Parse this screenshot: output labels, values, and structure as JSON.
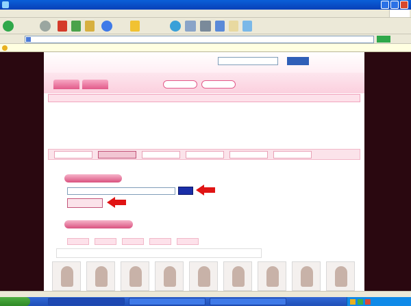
{
  "window": {
    "title": ""
  },
  "menu": {
    "items": [
      "",
      "",
      "",
      "",
      "",
      ""
    ]
  },
  "toolbar": {
    "back_label": "",
    "search_label": "",
    "favorites_label": ""
  },
  "address": {
    "label": "",
    "url": "",
    "go_label": "",
    "links_label": ""
  },
  "infobar": {
    "message": ""
  },
  "site": {
    "logo_primary": "",
    "logo_secondary": "",
    "tagline": "",
    "search_value": "",
    "search_button": "",
    "search_link": "",
    "main_tabs": [
      "",
      ""
    ],
    "sub_buttons": [
      "",
      ""
    ],
    "categories": [
      "",
      "",
      "",
      "",
      "",
      "",
      "",
      "",
      "",
      "",
      "",
      "",
      "",
      ""
    ],
    "ads": [
      {
        "title": "",
        "body": "",
        "url": ""
      },
      {
        "title": "",
        "body": "",
        "url": ""
      },
      {
        "title": "",
        "body": "",
        "url": ""
      },
      {
        "title": "",
        "body": "",
        "url": ""
      }
    ],
    "ads_by": "",
    "steps": [
      "",
      "",
      "",
      "",
      "",
      ""
    ],
    "upload_section_label": "",
    "browse_button": "",
    "upload_button": "",
    "gallery_section_label": "",
    "thumb_tabs": [
      "",
      "",
      "",
      "",
      ""
    ],
    "gallery_filter": ""
  },
  "annotations": {
    "step3": "",
    "step4": "",
    "arrow3_number": "",
    "arrow4_number": "",
    "overlay": ""
  },
  "statusbar": {
    "text": ""
  },
  "taskbar": {
    "start_label": "",
    "tasks": [
      "",
      "",
      ""
    ],
    "clock": ""
  },
  "colors": {
    "ie_blue": "#0840b8",
    "site_pink": "#e25a8a",
    "arrow_red": "#e01414",
    "overlay_purple": "#6a2cc4",
    "page_bg": "#2a0810"
  }
}
